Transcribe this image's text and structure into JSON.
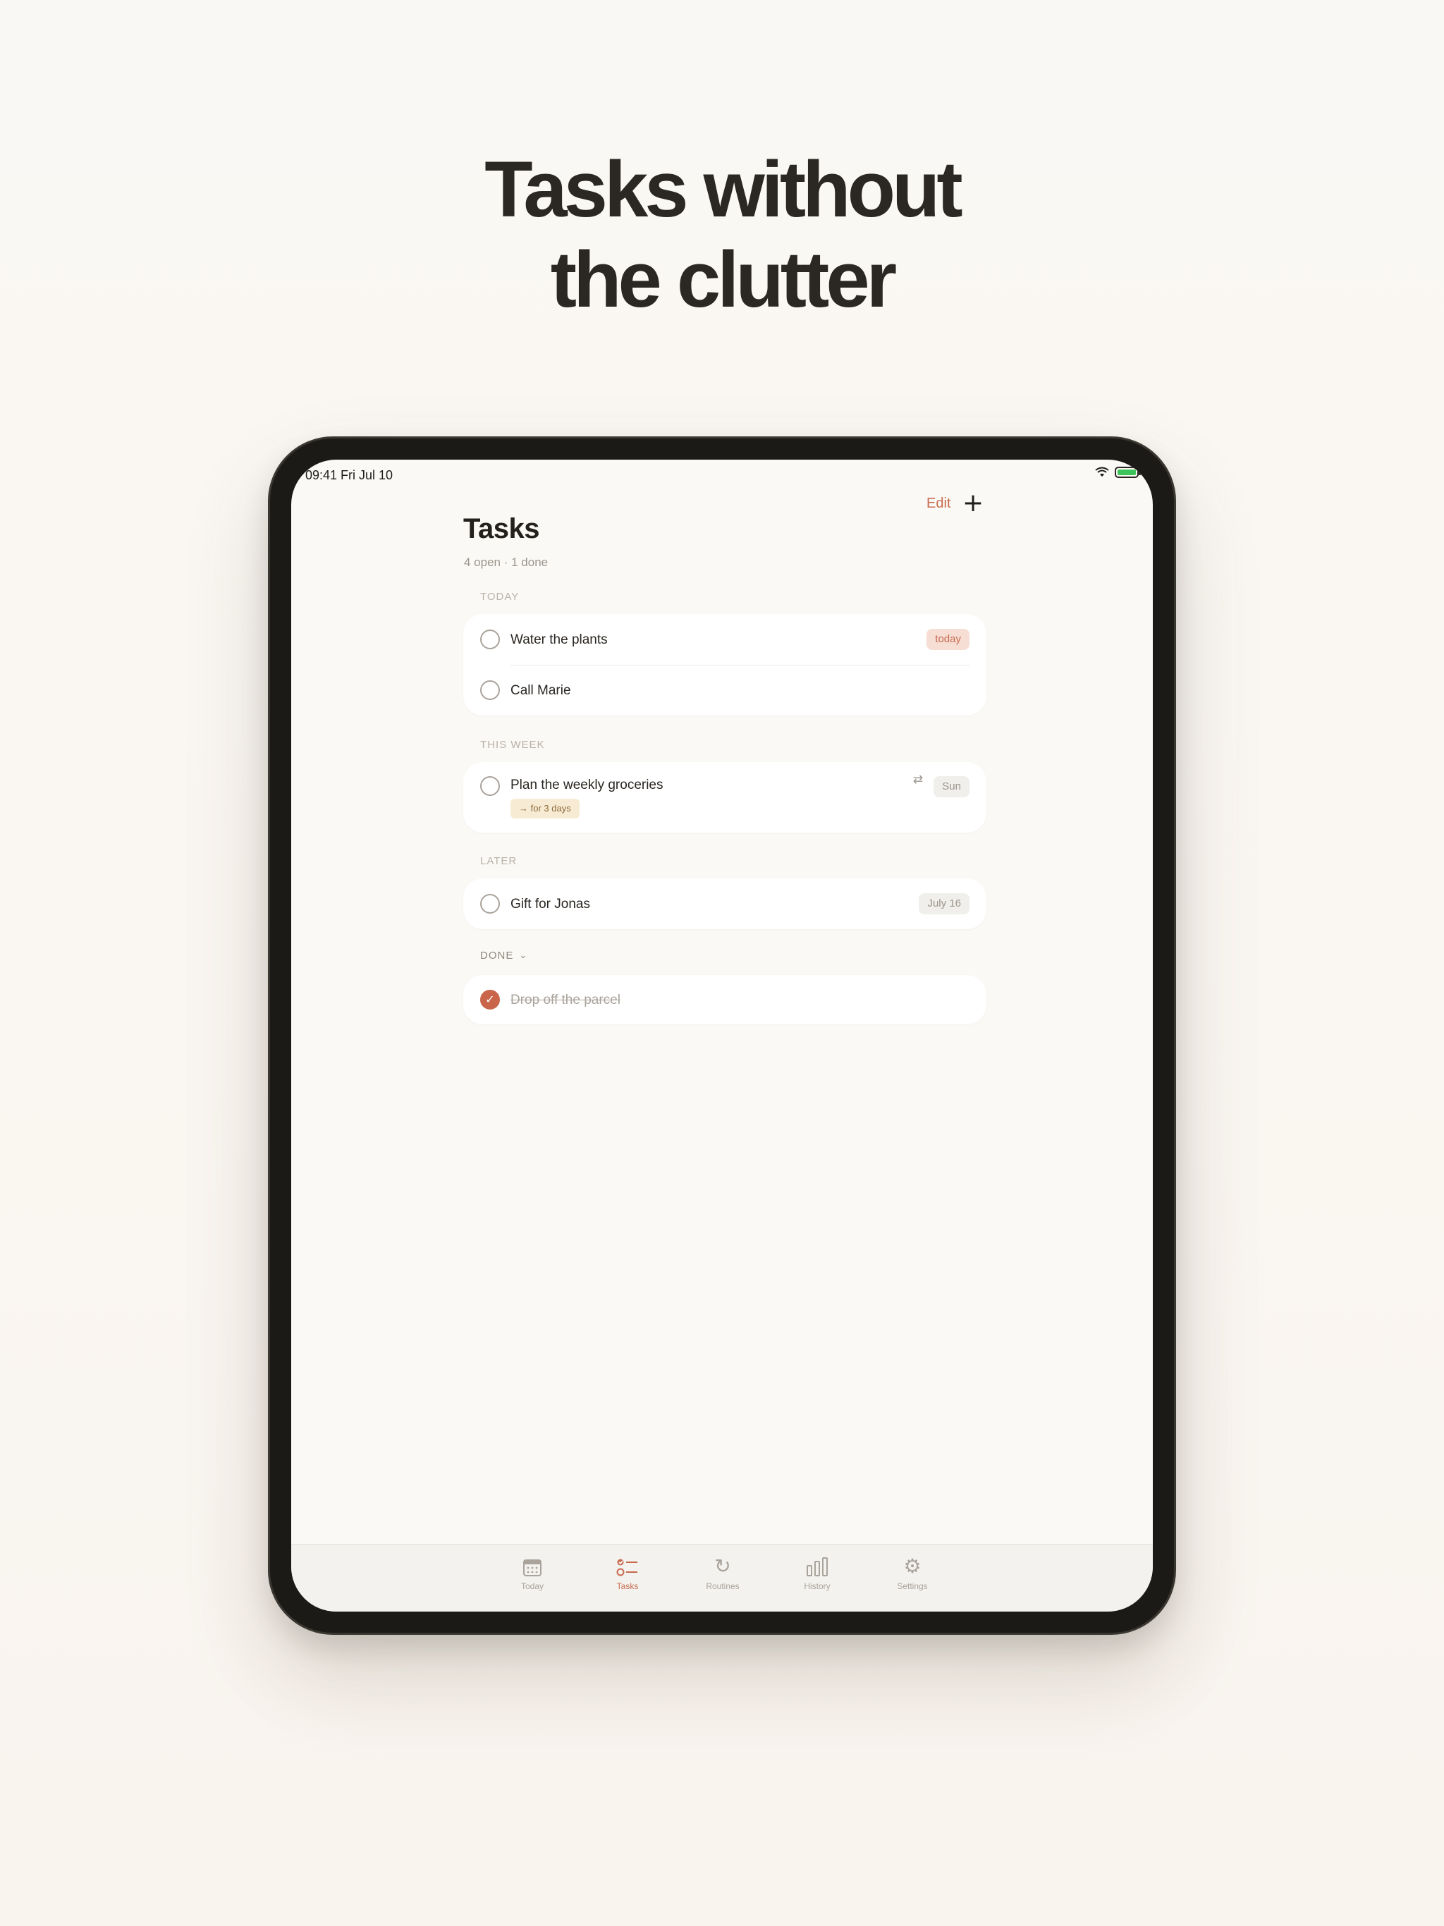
{
  "headline": {
    "line1": "Tasks without",
    "line2": "the clutter"
  },
  "status_bar": {
    "time": "09:41   Fri Jul 10",
    "wifi_icon": "wifi-icon",
    "battery_icon": "battery-icon"
  },
  "topbar": {
    "edit_label": "Edit",
    "add_label": "+"
  },
  "page": {
    "title": "Tasks",
    "subtitle": "4 open · 1 done"
  },
  "sections": {
    "today": {
      "label": "TODAY",
      "items": [
        {
          "title": "Water the plants",
          "badge": "today"
        },
        {
          "title": "Call Marie"
        }
      ]
    },
    "this_week": {
      "label": "THIS WEEK",
      "items": [
        {
          "title": "Plan the weekly groceries",
          "tag": "→ for 3 days",
          "badge": "Sun",
          "repeat_icon": "repeat-icon"
        }
      ]
    },
    "later": {
      "label": "LATER",
      "items": [
        {
          "title": "Gift for Jonas",
          "badge": "July 16"
        }
      ]
    },
    "done": {
      "label": "DONE",
      "items": [
        {
          "title": "Drop off the parcel"
        }
      ]
    }
  },
  "tabs": [
    {
      "label": "Today",
      "icon": "calendar-icon"
    },
    {
      "label": "Tasks",
      "icon": "checklist-icon",
      "active": true
    },
    {
      "label": "Routines",
      "icon": "routines-icon"
    },
    {
      "label": "History",
      "icon": "bar-chart-icon"
    },
    {
      "label": "Settings",
      "icon": "gear-icon"
    }
  ],
  "colors": {
    "accent": "#c76a4f",
    "background": "#fbf9f5",
    "text": "#2a2622"
  }
}
